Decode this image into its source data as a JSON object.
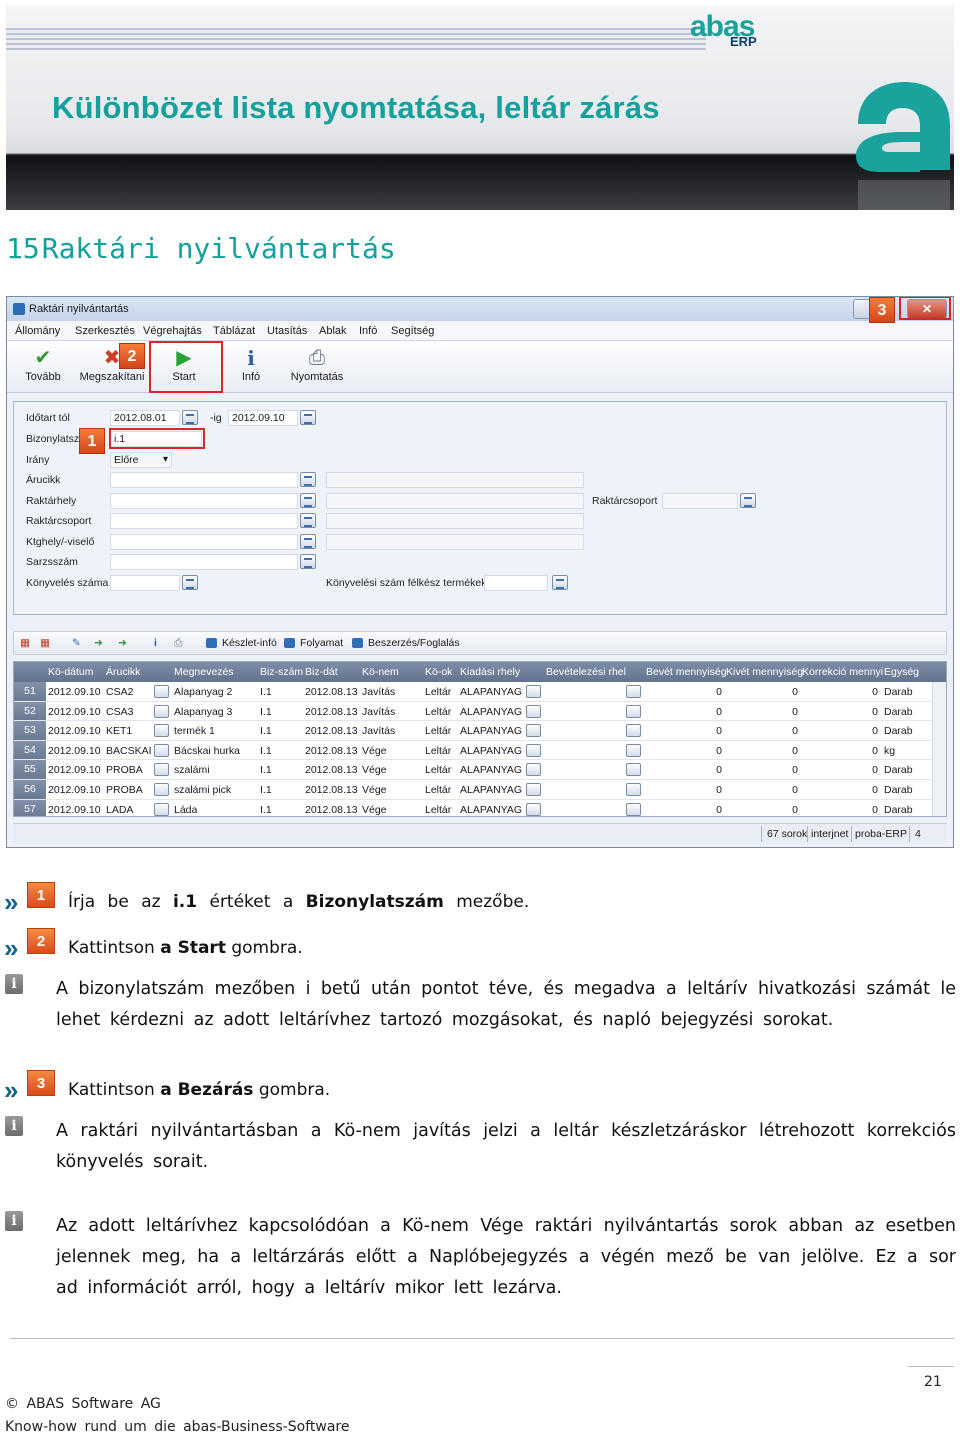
{
  "header": {
    "title": "Különbözet lista nyomtatása, leltár zárás",
    "logo_word": "abas",
    "logo_sub": "ERP"
  },
  "section": {
    "number": "15",
    "title": "Raktári nyilvántartás"
  },
  "window": {
    "title": "Raktári nyilvántartás",
    "close_glyph": "✕",
    "menu": [
      "Állomány",
      "Szerkesztés",
      "Végrehajtás",
      "Táblázat",
      "Utasítás",
      "Ablak",
      "Infó",
      "Segítség"
    ],
    "toolbar": {
      "tovabb": "Tovább",
      "megszakitani": "Megszakítani",
      "start": "Start",
      "info": "Infó",
      "nyomtatas": "Nyomtatás"
    },
    "form": {
      "labels": {
        "idotart": "Időtart tól",
        "ig": "-ig",
        "bizonylat": "Bizonylatszá",
        "irany": "Irány",
        "arucikk": "Árucikk",
        "raktarhely": "Raktárhely",
        "raktarcsoport": "Raktárcsoport",
        "ktghely": "Ktghely/-viselő",
        "sarzs": "Sarzsszám",
        "konyveles": "Könyvelés száma",
        "konyv_felkesz": "Könyvelési szám félkész termékek",
        "raktarcsoport_right": "Raktárcsoport"
      },
      "values": {
        "date_from": "2012.08.01",
        "date_to": "2012.09.10",
        "bizonylat": "i.1",
        "irany": "Előre"
      }
    },
    "grid_toolbar": {
      "keszlet": "Készlet-infó",
      "folyamat": "Folyamat",
      "beszerzes": "Beszerzés/Foglalás"
    },
    "columns": [
      "Kö-dátum",
      "Árucikk",
      "Megnevezés",
      "Biz-szám",
      "Biz-dát",
      "Kö-nem",
      "Kö-ok",
      "Kiadási rhely",
      "Bevételezési rhel",
      "Bevét mennyiség",
      "Kivét mennyiség",
      "Korrekció mennyi",
      "Egység"
    ],
    "rows": [
      {
        "rn": "51",
        "datum": "2012.09.10",
        "arucikk": "CSA2",
        "megnev": "Alapanyag 2",
        "biz": "I.1",
        "bizdat": "2012.08.13",
        "konem": "Javítás",
        "kook": "Leltár",
        "kiad": "ALAPANYAG",
        "bev": "0",
        "kiv": "0",
        "kor": "0",
        "egys": "Darab"
      },
      {
        "rn": "52",
        "datum": "2012.09.10",
        "arucikk": "CSA3",
        "megnev": "Alapanyag 3",
        "biz": "I.1",
        "bizdat": "2012.08.13",
        "konem": "Javítás",
        "kook": "Leltár",
        "kiad": "ALAPANYAG",
        "bev": "0",
        "kiv": "0",
        "kor": "0",
        "egys": "Darab"
      },
      {
        "rn": "53",
        "datum": "2012.09.10",
        "arucikk": "KET1",
        "megnev": "termék 1",
        "biz": "I.1",
        "bizdat": "2012.08.13",
        "konem": "Javítás",
        "kook": "Leltár",
        "kiad": "ALAPANYAG",
        "bev": "0",
        "kiv": "0",
        "kor": "0",
        "egys": "Darab"
      },
      {
        "rn": "54",
        "datum": "2012.09.10",
        "arucikk": "BACSKAI",
        "megnev": "Bácskai hurka",
        "biz": "I.1",
        "bizdat": "2012.08.13",
        "konem": "Vége",
        "kook": "Leltár",
        "kiad": "ALAPANYAG",
        "bev": "0",
        "kiv": "0",
        "kor": "0",
        "egys": "kg"
      },
      {
        "rn": "55",
        "datum": "2012.09.10",
        "arucikk": "PROBA",
        "megnev": "szalámi",
        "biz": "I.1",
        "bizdat": "2012.08.13",
        "konem": "Vége",
        "kook": "Leltár",
        "kiad": "ALAPANYAG",
        "bev": "0",
        "kiv": "0",
        "kor": "0",
        "egys": "Darab"
      },
      {
        "rn": "56",
        "datum": "2012.09.10",
        "arucikk": "PROBA",
        "megnev": "szalámi pick",
        "biz": "I.1",
        "bizdat": "2012.08.13",
        "konem": "Vége",
        "kook": "Leltár",
        "kiad": "ALAPANYAG",
        "bev": "0",
        "kiv": "0",
        "kor": "0",
        "egys": "Darab"
      },
      {
        "rn": "57",
        "datum": "2012.09.10",
        "arucikk": "LADA",
        "megnev": "Láda",
        "biz": "I.1",
        "bizdat": "2012.08.13",
        "konem": "Vége",
        "kook": "Leltár",
        "kiad": "ALAPANYAG",
        "bev": "0",
        "kiv": "0",
        "kor": "0",
        "egys": "Darab"
      }
    ],
    "status": {
      "rows": "67 sorok",
      "user": "interjnet",
      "db": "proba-ERP",
      "num": "4"
    },
    "callouts": [
      "1",
      "2",
      "3"
    ]
  },
  "steps": {
    "s1": {
      "badge": "1",
      "pre": "Írja be az ",
      "b1": "i.1",
      "mid": " értéket a ",
      "b2": "Bizonylatszám",
      "post": " mezőbe."
    },
    "s2": {
      "badge": "2",
      "pre": "Kattintson ",
      "b1": "a Start",
      "post": " gombra."
    },
    "s3": {
      "badge": "3",
      "pre": "Kattintson ",
      "b1": "a Bezárás",
      "post": " gombra."
    }
  },
  "notes": {
    "n1": "A bizonylatszám mezőben i betű után pontot téve, és megadva a leltárív hivatkozási számát le lehet kérdezni az adott leltárívhez tartozó mozgásokat, és napló bejegyzési sorokat.",
    "n2": "A raktári nyilvántartásban a Kö-nem javítás jelzi a leltár készletzáráskor létrehozott korrekciós könyvelés sorait.",
    "n3": "Az adott leltárívhez kapcsolódóan a Kö-nem Vége raktári nyilvántartás sorok abban az esetben jelennek meg, ha a leltárzárás előtt a Naplóbejegyzés a végén mező be van jelölve. Ez a sor ad információt arról, hogy a leltárív mikor lett lezárva."
  },
  "footer": {
    "page": "21",
    "line1": "© ABAS Software AG",
    "line2": "Know-how rund um die abas-Business-Software"
  }
}
